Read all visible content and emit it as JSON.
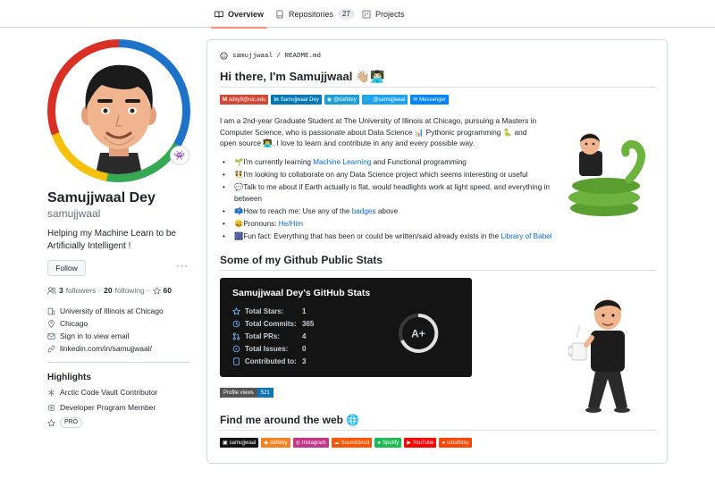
{
  "nav": {
    "overview": "Overview",
    "repositories": "Repositories",
    "repositories_count": "27",
    "projects": "Projects"
  },
  "profile": {
    "name": "Samujjwaal Dey",
    "login": "samujjwaal",
    "bio": "Helping my Machine Learn to be Artificially Intelligent !",
    "follow_label": "Follow",
    "more_label": "···",
    "followers_count": "3",
    "followers_label": "followers",
    "following_count": "20",
    "following_label": "following",
    "stars_count": "60",
    "status_emoji": "👾",
    "details": {
      "org": "University of Illinois at Chicago",
      "location": "Chicago",
      "email": "Sign in to view email",
      "website": "linkedin.com/in/samujjwaal/"
    },
    "highlights": {
      "title": "Highlights",
      "items": [
        "Arctic Code Vault Contributor",
        "Developer Program Member"
      ],
      "pro": "PRO"
    }
  },
  "readme": {
    "path": "samujjwaal / README.md",
    "heading": "Hi there, I'm Samujjwaal 👋🏼👨🏻‍💻",
    "badges": [
      {
        "label": "sdey9@uic.edu",
        "icon": "M",
        "color": "#d14836"
      },
      {
        "label": "Samujjwaal Dey",
        "icon": "in",
        "color": "#0077b5"
      },
      {
        "label": "@daftdey",
        "icon": "◉",
        "color": "#1c9fd6"
      },
      {
        "label": "@samujjwaal",
        "icon": "🐦",
        "color": "#1da1f2"
      },
      {
        "label": "Messenger",
        "icon": "✉",
        "color": "#0084ff"
      }
    ],
    "intro_1": "I am a 2nd-year Graduate Student at The University of Illinois at Chicago, pursuing a Masters in Computer Science, who is passionate about Data Science 📊 Pythonic programming 🐍 and open source 👨‍💻. I love to learn and contribute in any and every possible way.",
    "bullets": [
      {
        "pre": "🌱I'm currently learning ",
        "link": "Machine Learning",
        "post": " and Functional programming"
      },
      {
        "pre": "👯I'm looking to collaborate on any Data Science project which seems interesting or useful",
        "link": "",
        "post": ""
      },
      {
        "pre": "💬Talk to me about if Earth actually is flat, would headlights work at light speed, and everything in between",
        "link": "",
        "post": ""
      },
      {
        "pre": "📫How to reach me: Use any of the ",
        "link": "badges",
        "post": " above"
      },
      {
        "pre": "😄Pronouns: ",
        "link": "He/Him",
        "post": ""
      },
      {
        "pre": "🎆Fun fact: Everything that has been or could be written/said already exists in the ",
        "link": "Library of Babel",
        "post": ""
      }
    ],
    "stats_heading": "Some of my Github Public Stats",
    "stats": {
      "title": "Samujjwaal Dey's GitHub Stats",
      "rows": [
        {
          "label": "Total Stars:",
          "value": "1"
        },
        {
          "label": "Total Commits:",
          "value": "365"
        },
        {
          "label": "Total PRs:",
          "value": "4"
        },
        {
          "label": "Total Issues:",
          "value": "0"
        },
        {
          "label": "Contributed to:",
          "value": "3"
        }
      ],
      "grade": "A+",
      "accent": "#ffffff"
    },
    "views_label": "Profile views",
    "views_count": "521",
    "find_heading": "Find me around the web 🌐",
    "social": [
      {
        "label": "samujjwaal",
        "icon": "▣",
        "color": "#111111"
      },
      {
        "label": "daftdey",
        "icon": "◆",
        "color": "#f48024"
      },
      {
        "label": "Instagram",
        "icon": "◎",
        "color": "#c13584"
      },
      {
        "label": "Soundcloud",
        "icon": "☁",
        "color": "#ff5500"
      },
      {
        "label": "Spotify",
        "icon": "●",
        "color": "#1db954"
      },
      {
        "label": "YouTube",
        "icon": "▶",
        "color": "#ff0000"
      },
      {
        "label": "u/daftdey",
        "icon": "●",
        "color": "#ff4500"
      }
    ]
  }
}
